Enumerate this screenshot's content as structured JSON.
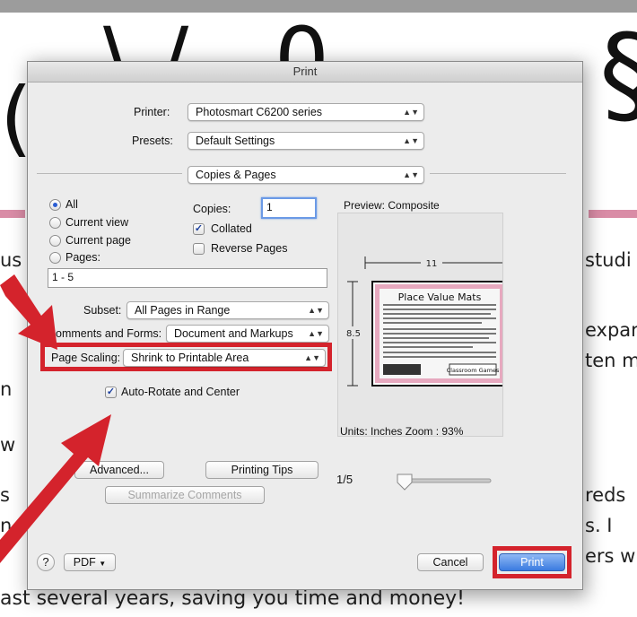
{
  "background": {
    "big_chars": "\\ / - 0",
    "text_fragments": [
      "us",
      "n",
      "w",
      "s",
      "n",
      "studi",
      "expar",
      "ten m",
      "reds",
      "s. I",
      "ers w"
    ],
    "footer_line": "ast several years, saving you time and money!",
    "accent_color": "#d98ca6"
  },
  "dialog": {
    "title": "Print",
    "printer_label": "Printer:",
    "printer_value": "Photosmart C6200 series",
    "presets_label": "Presets:",
    "presets_value": "Default Settings",
    "panel_value": "Copies & Pages",
    "pages": {
      "all": "All",
      "current_view": "Current view",
      "current_page": "Current page",
      "pages": "Pages:",
      "range_value": "1 - 5",
      "selected": "All"
    },
    "copies_label": "Copies:",
    "copies_value": "1",
    "collated_label": "Collated",
    "reverse_label": "Reverse Pages",
    "subset_label": "Subset:",
    "subset_value": "All Pages in Range",
    "comments_label": "Comments and Forms:",
    "comments_value": "Document and Markups",
    "scaling_label": "Page Scaling:",
    "scaling_value": "Shrink to Printable Area",
    "autorotate_label": "Auto-Rotate and Center",
    "advanced_button": "Advanced...",
    "tips_button": "Printing Tips",
    "summarize_button": "Summarize Comments",
    "preview_label": "Preview: Composite",
    "preview_width": "11",
    "preview_height": "8.5",
    "preview_doc_title": "Place Value Mats",
    "preview_doc_brand": "Classroom Games",
    "units_label": "Units: Inches Zoom :  93%",
    "page_counter": "1/5",
    "help_icon": "?",
    "pdf_button": "PDF",
    "cancel_button": "Cancel",
    "print_button": "Print"
  },
  "colors": {
    "highlight": "#d4232c",
    "accent_blue": "#2a5dd3"
  }
}
